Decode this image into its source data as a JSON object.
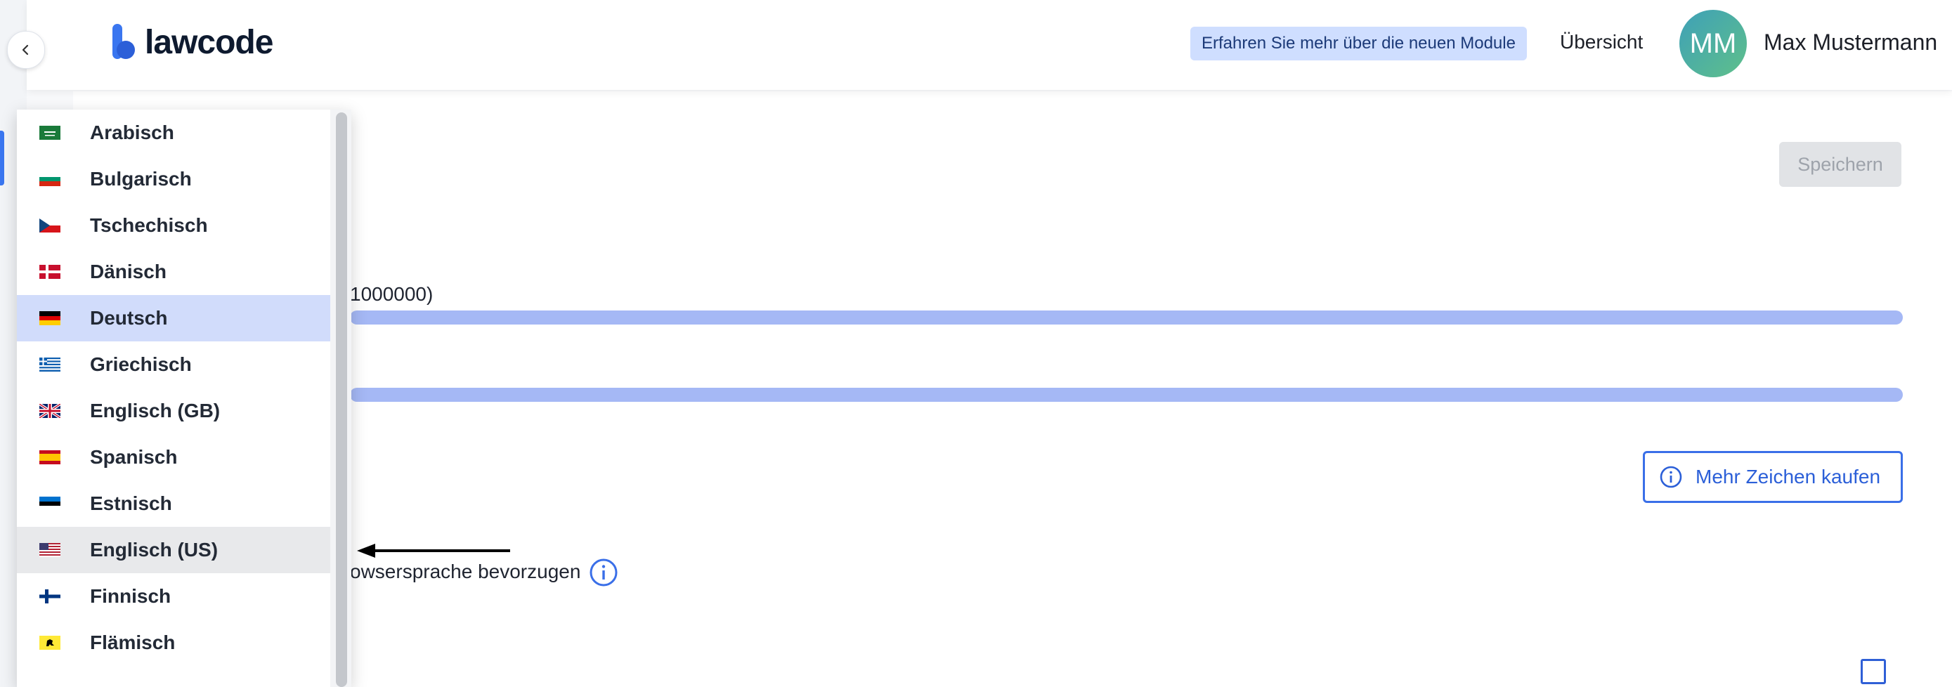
{
  "header": {
    "logo_text": "lawcode",
    "promo_label": "Erfahren Sie mehr über die neuen Module",
    "nav_overview": "Übersicht",
    "avatar_initials": "MM",
    "user_name": "Max Mustermann"
  },
  "main": {
    "save_label": "Speichern",
    "char_limit_text_visible": "1000000)",
    "buy_button_label": "Mehr Zeichen kaufen",
    "preference_text_visible": "owsersprache bevorzugen"
  },
  "language_dropdown": {
    "selected": "Deutsch",
    "hovered": "Englisch (US)",
    "items": [
      {
        "label": "Arabisch",
        "flag": "flag-sa"
      },
      {
        "label": "Bulgarisch",
        "flag": "flag-bg"
      },
      {
        "label": "Tschechisch",
        "flag": "flag-cz"
      },
      {
        "label": "Dänisch",
        "flag": "flag-dk"
      },
      {
        "label": "Deutsch",
        "flag": "flag-de"
      },
      {
        "label": "Griechisch",
        "flag": "flag-gr"
      },
      {
        "label": "Englisch (GB)",
        "flag": "flag-gb"
      },
      {
        "label": "Spanisch",
        "flag": "flag-es"
      },
      {
        "label": "Estnisch",
        "flag": "flag-ee"
      },
      {
        "label": "Englisch (US)",
        "flag": "flag-us"
      },
      {
        "label": "Finnisch",
        "flag": "flag-fi"
      },
      {
        "label": "Flämisch",
        "flag": "flag-flanders"
      }
    ]
  },
  "colors": {
    "accent": "#3a76f0",
    "selected_row": "#d1dcfb",
    "hover_row": "#e8e9eb",
    "progress_bar": "#a5b8f5",
    "promo_bg": "#cfdeff"
  }
}
